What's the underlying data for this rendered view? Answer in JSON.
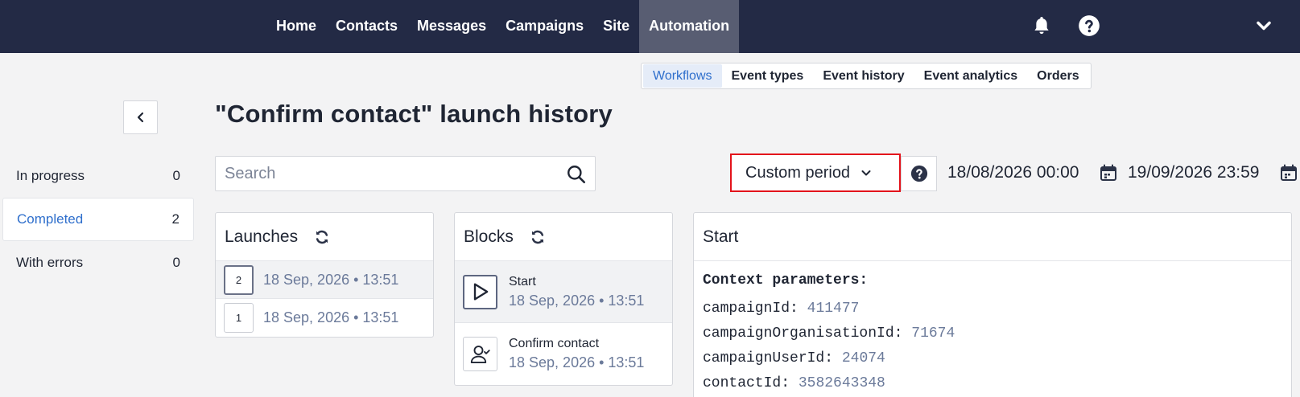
{
  "nav": {
    "items": [
      {
        "label": "Home"
      },
      {
        "label": "Contacts"
      },
      {
        "label": "Messages"
      },
      {
        "label": "Campaigns"
      },
      {
        "label": "Site"
      },
      {
        "label": "Automation",
        "active": true
      }
    ],
    "icons": [
      "bell-icon",
      "question-circle-icon",
      "chevron-down-icon"
    ]
  },
  "subnav": {
    "items": [
      {
        "label": "Workflows",
        "active": true
      },
      {
        "label": "Event types"
      },
      {
        "label": "Event history"
      },
      {
        "label": "Event analytics"
      },
      {
        "label": "Orders"
      }
    ]
  },
  "page": {
    "title": "\"Confirm contact\" launch history"
  },
  "status_filter": {
    "items": [
      {
        "label": "In progress",
        "count": "0"
      },
      {
        "label": "Completed",
        "count": "2",
        "active": true
      },
      {
        "label": "With errors",
        "count": "0"
      }
    ]
  },
  "search": {
    "placeholder": "Search",
    "value": ""
  },
  "period": {
    "label": "Custom period",
    "from": "18/08/2026 00:00",
    "to": "19/09/2026 23:59"
  },
  "launches": {
    "title": "Launches",
    "rows": [
      {
        "num": "2",
        "date": "18 Sep, 2026 • 13:51",
        "active": true
      },
      {
        "num": "1",
        "date": "18 Sep, 2026 • 13:51"
      }
    ]
  },
  "blocks": {
    "title": "Blocks",
    "rows": [
      {
        "name": "Start",
        "date": "18 Sep, 2026 • 13:51",
        "icon": "play-icon",
        "active": true
      },
      {
        "name": "Confirm contact",
        "date": "18 Sep, 2026 • 13:51",
        "icon": "user-check-icon"
      }
    ]
  },
  "details": {
    "title": "Start",
    "context_title": "Context parameters:",
    "params": [
      {
        "key": "campaignId:",
        "value": "411477"
      },
      {
        "key": "campaignOrganisationId:",
        "value": "71674"
      },
      {
        "key": "campaignUserId:",
        "value": "24074"
      },
      {
        "key": "contactId:",
        "value": "3582643348"
      }
    ]
  },
  "colors": {
    "topbar": "#232a45",
    "accent": "#2f6fcc",
    "highlight_border": "#e3131b",
    "muted_value": "#6b7a9a"
  }
}
